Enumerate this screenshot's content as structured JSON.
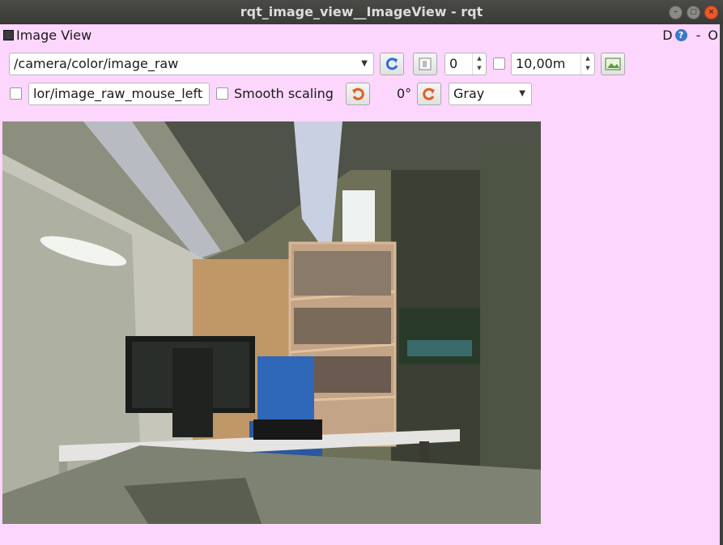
{
  "window": {
    "title": "rqt_image_view__ImageView - rqt"
  },
  "plugin": {
    "title": "Image View",
    "help_label": "D",
    "help_icon": "?",
    "minimize_label": "-",
    "close_label": "O"
  },
  "toolbar": {
    "topic_value": "/camera/color/image_raw",
    "frame_skip_value": "0",
    "max_range_value": "10,00m",
    "mouse_topic_value": "lor/image_raw_mouse_left",
    "smooth_scaling_label": "Smooth scaling",
    "rotation_label": "0°",
    "color_scheme_value": "Gray"
  },
  "icons": {
    "refresh": "refresh-icon",
    "zoom": "zoom-icon",
    "save": "save-image-icon",
    "rotate_left": "rotate-left-icon",
    "rotate_right": "rotate-right-icon"
  },
  "colors": {
    "background": "#fcd6fc",
    "titlebar": "#3c3c39",
    "accent_blue": "#2a6fcf",
    "accent_orange": "#e0601a"
  }
}
